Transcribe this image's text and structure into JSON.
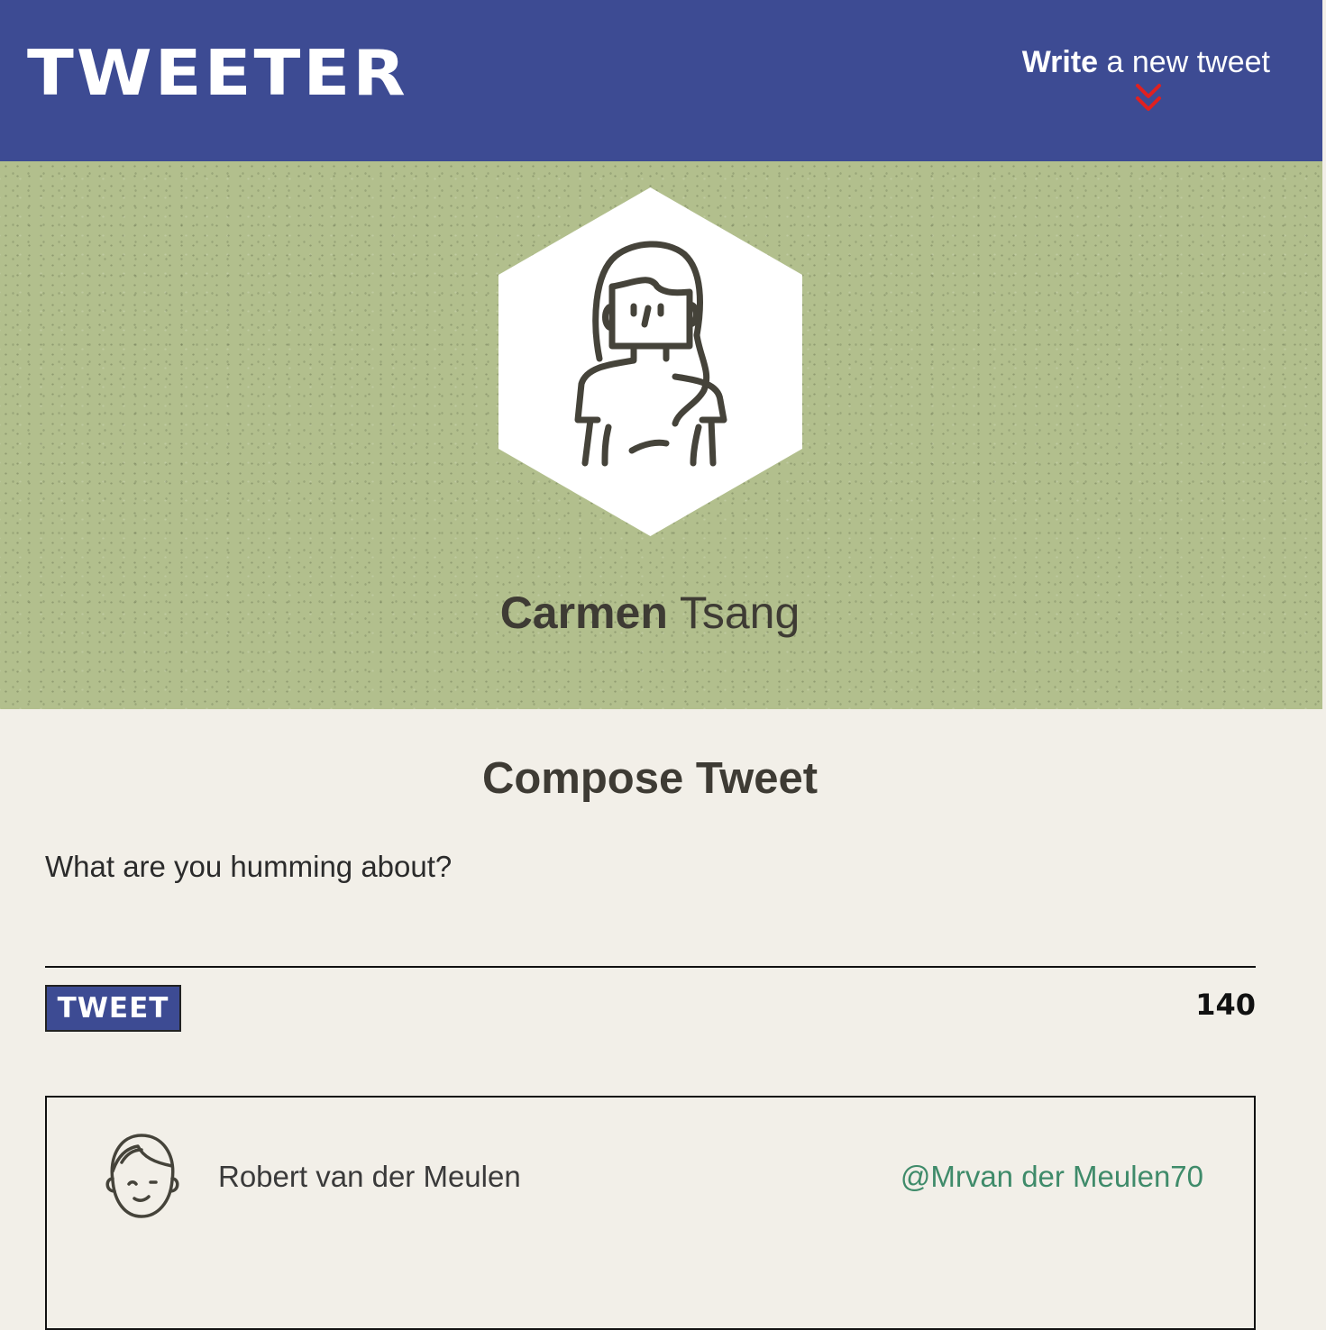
{
  "nav": {
    "brand": "TWEETER",
    "write_strong": "Write",
    "write_rest": "a new tweet",
    "chevron_icon": "double-chevron-down-icon",
    "chevron_color": "#e02020",
    "background": "#3d4b93"
  },
  "profile": {
    "avatar_icon": "woman-avatar-icon",
    "first_name": "Carmen",
    "last_name": "Tsang",
    "background": "#b2bf8d"
  },
  "compose": {
    "title": "Compose Tweet",
    "placeholder": "What are you humming about?",
    "value": "",
    "button_label": "TWEET",
    "counter": "140"
  },
  "tweets": [
    {
      "avatar_icon": "man-avatar-icon",
      "author": "Robert van der Meulen",
      "handle": "@Mrvan der Meulen70"
    }
  ]
}
